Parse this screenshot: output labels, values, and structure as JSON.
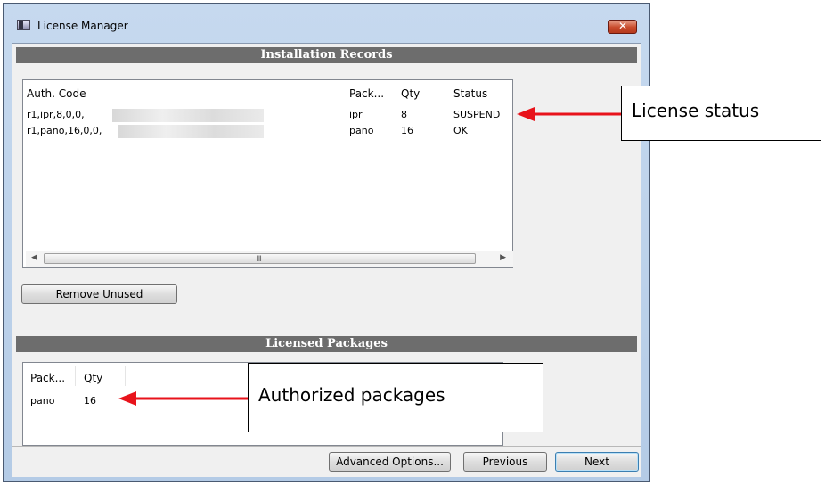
{
  "window": {
    "title": "License Manager"
  },
  "installation_records": {
    "header": "Installation Records",
    "columns": [
      "Auth. Code",
      "Pack...",
      "Qty",
      "Status"
    ],
    "rows": [
      {
        "auth_code": "r1,ipr,8,0,0,",
        "package": "ipr",
        "qty": "8",
        "status": "SUSPEND"
      },
      {
        "auth_code": "r1,pano,16,0,0,",
        "package": "pano",
        "qty": "16",
        "status": "OK"
      }
    ],
    "scrollbar_grip": "III",
    "remove_unused_label": "Remove Unused"
  },
  "licensed_packages": {
    "header": "Licensed Packages",
    "columns": [
      "Pack...",
      "Qty"
    ],
    "rows": [
      {
        "package": "pano",
        "qty": "16"
      }
    ]
  },
  "footer": {
    "advanced_label": "Advanced Options...",
    "previous_label": "Previous",
    "next_label": "Next"
  },
  "annotations": {
    "license_status": "License status",
    "authorized_packages": "Authorized packages",
    "arrow_color": "#e8131b"
  }
}
